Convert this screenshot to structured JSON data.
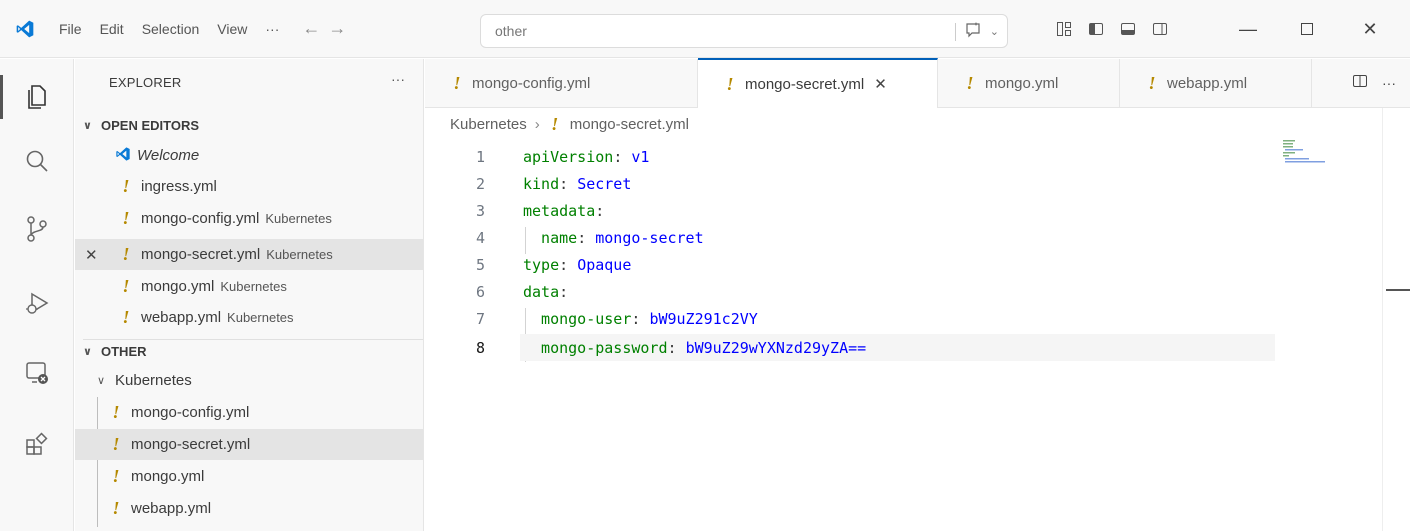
{
  "titlebar": {
    "menu": [
      "File",
      "Edit",
      "Selection",
      "View",
      "···"
    ],
    "search_value": "other"
  },
  "activity_icons": [
    "files-icon",
    "search-icon",
    "source-control-icon",
    "run-debug-icon",
    "remote-explorer-icon",
    "extensions-icon"
  ],
  "sidebar": {
    "title": "EXPLORER",
    "more": "···",
    "open_editors": {
      "label": "OPEN EDITORS",
      "items": [
        {
          "name": "Welcome",
          "desc": ""
        },
        {
          "name": "ingress.yml",
          "desc": ""
        },
        {
          "name": "mongo-config.yml",
          "desc": "Kubernetes"
        },
        {
          "name": "mongo-secret.yml",
          "desc": "Kubernetes"
        },
        {
          "name": "mongo.yml",
          "desc": "Kubernetes"
        },
        {
          "name": "webapp.yml",
          "desc": "Kubernetes"
        }
      ]
    },
    "other": {
      "label": "OTHER",
      "folder": "Kubernetes",
      "files": [
        "mongo-config.yml",
        "mongo-secret.yml",
        "mongo.yml",
        "webapp.yml"
      ]
    }
  },
  "tabs": [
    "mongo-config.yml",
    "mongo-secret.yml",
    "mongo.yml",
    "webapp.yml"
  ],
  "breadcrumb": {
    "folder": "Kubernetes",
    "file": "mongo-secret.yml"
  },
  "editor": {
    "lines": [
      {
        "n": "1",
        "key": "apiVersion",
        "value": "v1"
      },
      {
        "n": "2",
        "key": "kind",
        "value": "Secret"
      },
      {
        "n": "3",
        "key": "metadata",
        "value": ""
      },
      {
        "n": "4",
        "key": "  name",
        "value": "mongo-secret"
      },
      {
        "n": "5",
        "key": "type",
        "value": "Opaque"
      },
      {
        "n": "6",
        "key": "data",
        "value": ""
      },
      {
        "n": "7",
        "key": "  mongo-user",
        "value": "bW9uZ291c2VY"
      },
      {
        "n": "8",
        "key": "  mongo-password",
        "value": "bW9uZ29wYXNzd29yZA=="
      }
    ]
  },
  "colors": {
    "accent": "#005fb8",
    "yaml_icon": "#b58900",
    "key": "#008000",
    "value": "#0000ff"
  }
}
